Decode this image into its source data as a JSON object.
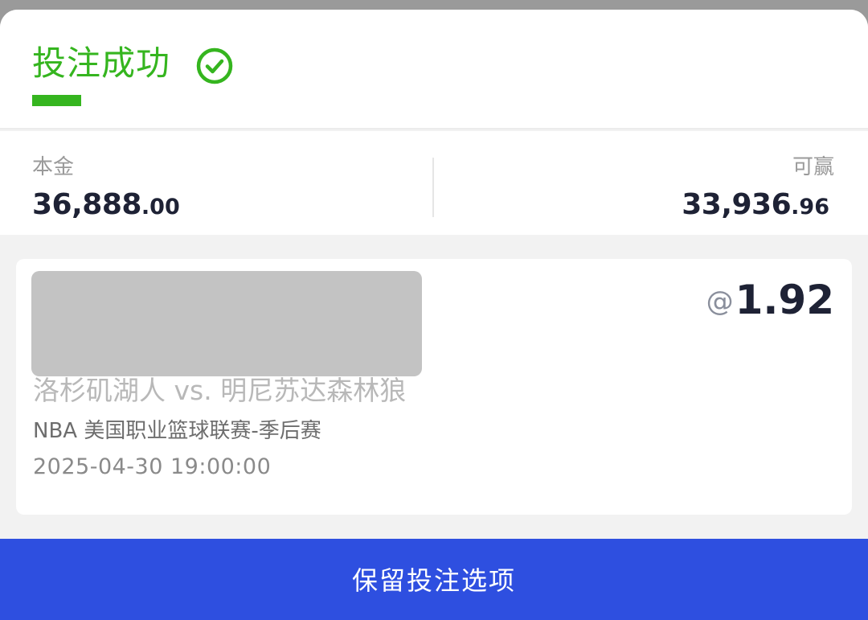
{
  "header": {
    "title": "投注成功",
    "status_icon": "check-circle-icon",
    "accent_color": "#35b51f"
  },
  "summary": {
    "principal_label": "本金",
    "principal_int": "36,888",
    "principal_dec": ".00",
    "win_label": "可赢",
    "win_int": "33,936",
    "win_dec": ".96"
  },
  "bet": {
    "odds_prefix": "@",
    "odds": "1.92",
    "match": "洛杉矶湖人 vs. 明尼苏达森林狼",
    "league": "NBA 美国职业篮球联赛-季后赛",
    "time": "2025-04-30 19:00:00"
  },
  "footer": {
    "keep_button_label": "保留投注选项",
    "button_color": "#2e4fe0"
  }
}
